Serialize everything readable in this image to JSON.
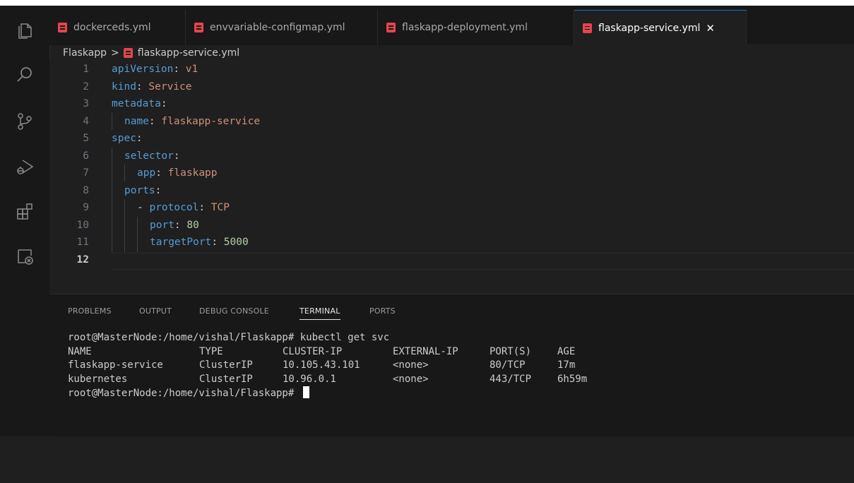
{
  "tabs": [
    {
      "label": "dockerceds.yml",
      "active": false
    },
    {
      "label": "envvariable-configmap.yml",
      "active": false
    },
    {
      "label": "flaskapp-deployment.yml",
      "active": false
    },
    {
      "label": "flaskapp-service.yml",
      "active": true
    }
  ],
  "tab_close_glyph": "✕",
  "breadcrumb": {
    "folder": "Flaskapp",
    "separator": ">",
    "file": "flaskapp-service.yml"
  },
  "editor": {
    "line_numbers": [
      "1",
      "2",
      "3",
      "4",
      "5",
      "6",
      "7",
      "8",
      "9",
      "10",
      "11",
      "12"
    ],
    "lines": [
      {
        "key": "apiVersion",
        "colon": ":",
        "value": " v1",
        "dash": ""
      },
      {
        "key": "kind",
        "colon": ":",
        "value": " Service",
        "dash": ""
      },
      {
        "key": "metadata",
        "colon": ":",
        "value": "",
        "dash": ""
      },
      {
        "key": "name",
        "colon": ":",
        "value": " flaskapp-service",
        "dash": ""
      },
      {
        "key": "spec",
        "colon": ":",
        "value": "",
        "dash": ""
      },
      {
        "key": "selector",
        "colon": ":",
        "value": "",
        "dash": ""
      },
      {
        "key": "app",
        "colon": ":",
        "value": " flaskapp",
        "dash": ""
      },
      {
        "key": "ports",
        "colon": ":",
        "value": "",
        "dash": ""
      },
      {
        "key": "protocol",
        "colon": ":",
        "value": " TCP",
        "dash": "- "
      },
      {
        "key": "port",
        "colon": ":",
        "value": " 80",
        "dash": ""
      },
      {
        "key": "targetPort",
        "colon": ":",
        "value": " 5000",
        "dash": ""
      },
      {
        "key": "",
        "colon": "",
        "value": "",
        "dash": ""
      }
    ]
  },
  "panel": {
    "tabs": [
      "PROBLEMS",
      "OUTPUT",
      "DEBUG CONSOLE",
      "TERMINAL",
      "PORTS"
    ],
    "active_tab": "TERMINAL"
  },
  "terminal": {
    "command_line": "root@MasterNode:/home/vishal/Flaskapp# kubectl get svc",
    "headers": [
      "NAME",
      "TYPE",
      "CLUSTER-IP",
      "EXTERNAL-IP",
      "PORT(S)",
      "AGE"
    ],
    "rows": [
      [
        "flaskapp-service",
        "ClusterIP",
        "10.105.43.101",
        "<none>",
        "80/TCP",
        "17m"
      ],
      [
        "kubernetes",
        "ClusterIP",
        "10.96.0.1",
        "<none>",
        "443/TCP",
        "6h59m"
      ]
    ],
    "prompt": "root@MasterNode:/home/vishal/Flaskapp# "
  },
  "activity_icons": [
    "explorer-icon",
    "search-icon",
    "source-control-icon",
    "run-debug-icon",
    "extensions-icon",
    "remote-explorer-icon"
  ],
  "colors": {
    "accent": "#0078d4",
    "yaml_icon": "#e5454e",
    "key": "#569cd6",
    "string": "#ce9178",
    "number": "#b5cea8"
  }
}
